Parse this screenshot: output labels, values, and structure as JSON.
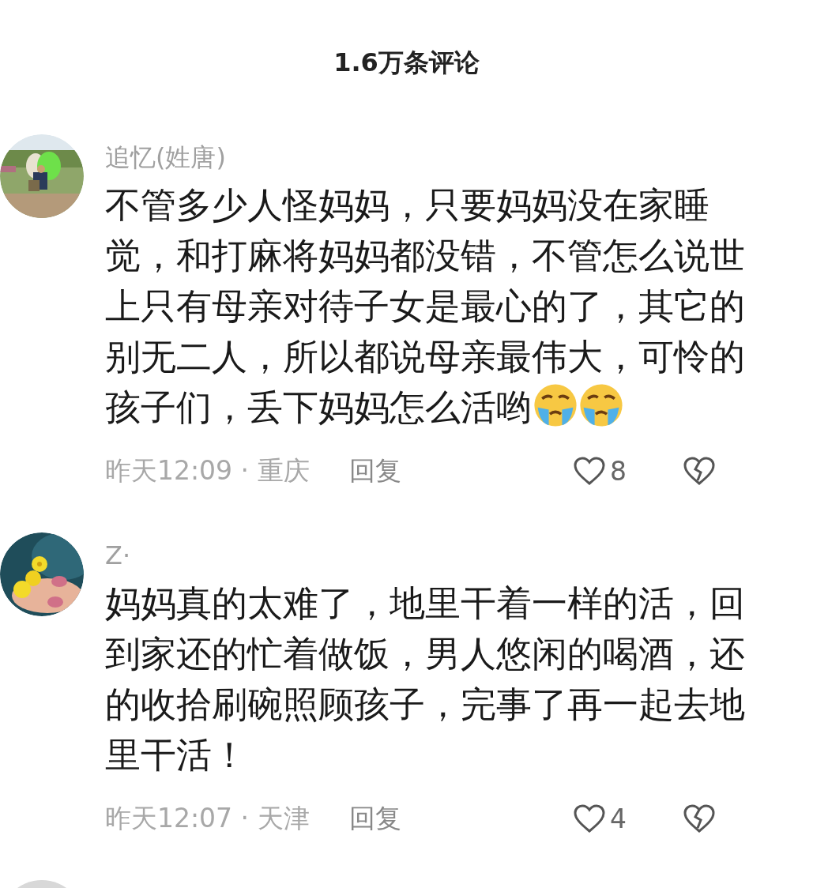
{
  "header": {
    "title": "1.6万条评论"
  },
  "comments": [
    {
      "avatar": {
        "kind": "picture"
      },
      "username": "追忆(姓唐)",
      "text": "不管多少人怪妈妈，只要妈妈没在家睡觉，和打麻将妈妈都没错，不管怎么说世上只有母亲对待子女是最心的了，其它的别无二人，所以都说母亲最伟大，可怜的孩子们，丢下妈妈怎么活哟",
      "emojis": [
        {
          "kind": "crying"
        },
        {
          "kind": "crying"
        }
      ],
      "meta": "昨天12:09 · 重庆",
      "reply": "回复",
      "likes": "8"
    },
    {
      "avatar": {
        "kind": "picture"
      },
      "username": "Z·",
      "text": "妈妈真的太难了，地里干着一样的活，回到家还的忙着做饭，男人悠闲的喝酒，还的收拾刷碗照顾孩子，完事了再一起去地里干活！",
      "meta": "昨天12:07 · 天津",
      "reply": "回复",
      "likes": "4"
    },
    {
      "avatar": {
        "kind": "placeholder"
      }
    }
  ]
}
